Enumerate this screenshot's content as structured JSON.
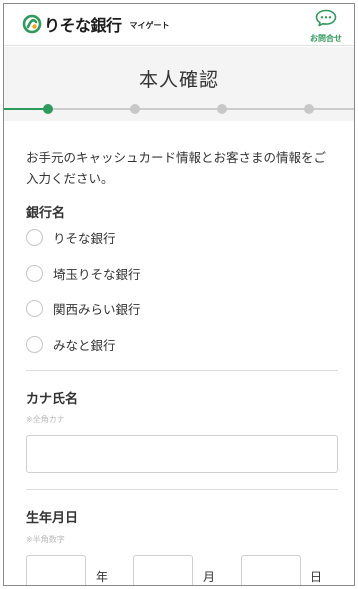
{
  "header": {
    "logo_text": "りそな銀行",
    "logo_sub": "マイゲート",
    "inquiry_label": "お問合せ"
  },
  "page": {
    "title": "本人確認"
  },
  "stepper": {
    "total_steps": 4,
    "current_step": 1
  },
  "form": {
    "intro": "お手元のキャッシュカード情報とお客さまの情報をご入力ください。",
    "bank": {
      "label": "銀行名",
      "options": [
        "りそな銀行",
        "埼玉りそな銀行",
        "関西みらい銀行",
        "みなと銀行"
      ]
    },
    "kana_name": {
      "label": "カナ氏名",
      "hint": "※全角カナ",
      "value": ""
    },
    "birthdate": {
      "label": "生年月日",
      "hint": "※半角数字",
      "year_unit": "年",
      "month_unit": "月",
      "day_unit": "日"
    }
  },
  "colors": {
    "accent": "#2e9a5c",
    "inactive": "#c8c8c8",
    "background": "#f4f4f4"
  }
}
